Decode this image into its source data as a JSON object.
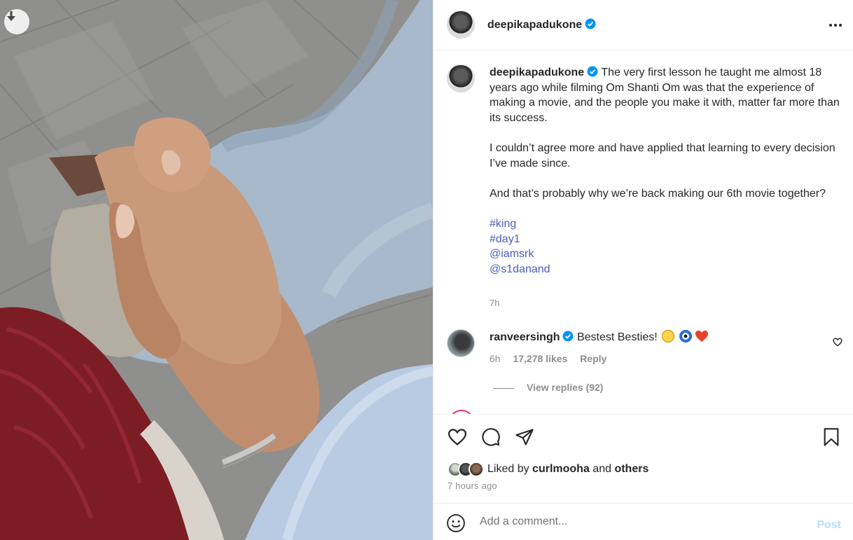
{
  "post": {
    "username": "deepikapadukone",
    "verified": true,
    "caption_paragraphs": [
      "The very first lesson he taught me almost 18 years ago while filming Om Shanti Om was that the experience of making a movie, and the people you make it with, matter far more than its success.",
      "I couldn’t agree more and have applied that learning to every decision I’ve made since.",
      "And that’s probably why we’re back making our 6th movie together?"
    ],
    "tags": [
      "#king",
      "#day1",
      "@iamsrk",
      "@s1danand"
    ],
    "caption_time": "7h"
  },
  "comment": {
    "username": "ranveersingh",
    "text": "Bestest Besties!",
    "emojis": [
      "smiling-face-with-halo",
      "nazar-amulet",
      "red-heart"
    ],
    "time": "6h",
    "likes": "17,278 likes",
    "reply_label": "Reply",
    "view_replies": "View replies (92)"
  },
  "actions": {
    "liked_by_prefix": "Liked by",
    "liked_by_user": "curlmooha",
    "liked_by_and": "and",
    "liked_by_others": "others",
    "post_time": "7 hours ago"
  },
  "comment_box": {
    "placeholder": "Add a comment...",
    "post_label": "Post"
  },
  "colors": {
    "accent_link": "#4a5fc0",
    "verified_blue": "#0095f6",
    "post_button_disabled": "#b2dffc",
    "secondary_text": "#8e8e8e"
  }
}
